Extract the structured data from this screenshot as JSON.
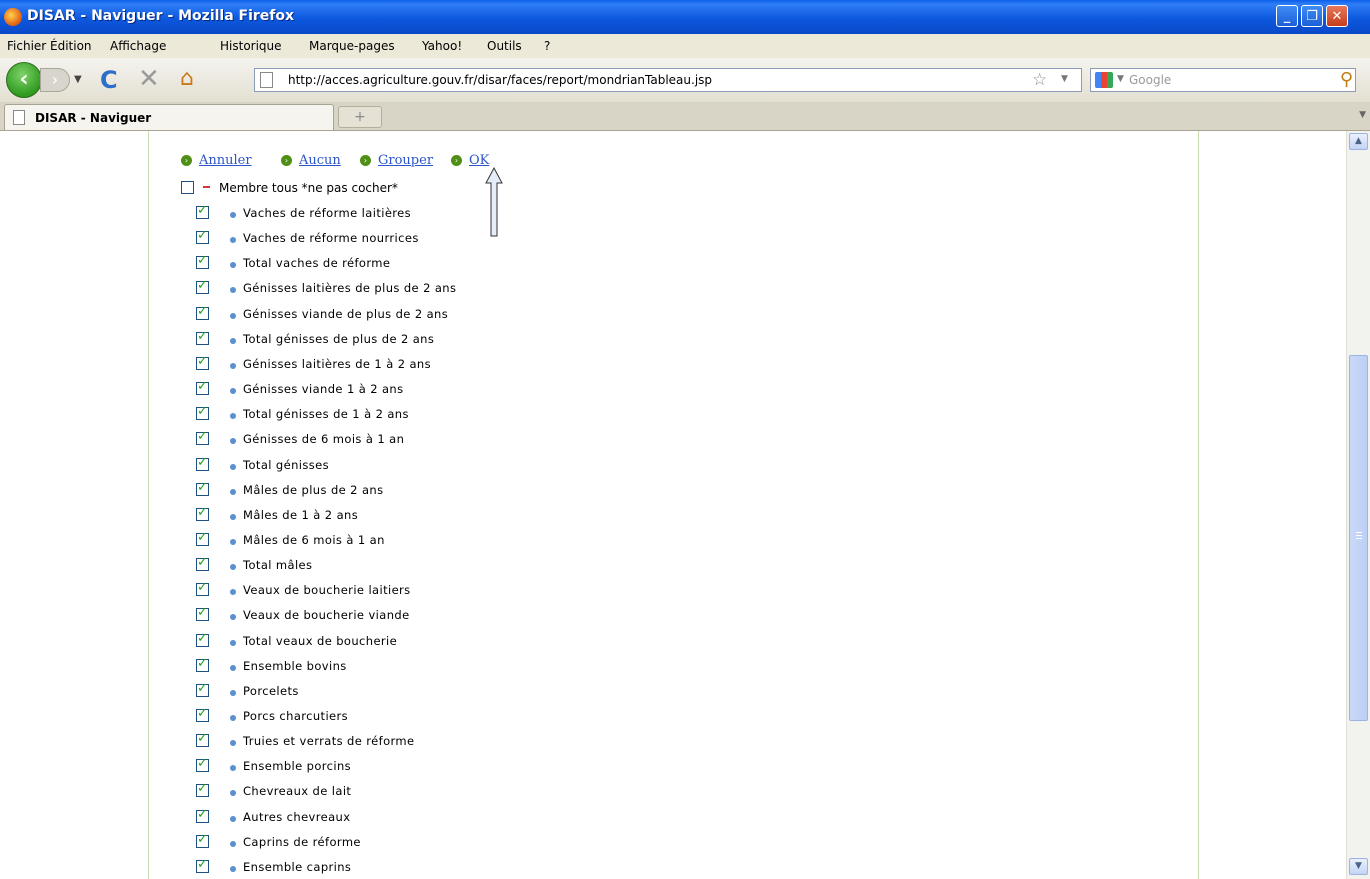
{
  "window": {
    "title": "DISAR - Naviguer - Mozilla Firefox"
  },
  "menu": [
    "Fichier",
    "Édition",
    "Affichage",
    "Historique",
    "Marque-pages",
    "Yahoo!",
    "Outils",
    "?"
  ],
  "nav": {
    "url": "http://acces.agriculture.gouv.fr/disar/faces/report/mondrianTableau.jsp",
    "search_placeholder": "Google"
  },
  "tab": {
    "label": "DISAR - Naviguer"
  },
  "actions": [
    "Annuler",
    "Aucun",
    "Grouper",
    "OK"
  ],
  "tree": {
    "root": {
      "label": "Membre tous *ne pas cocher*",
      "checked": false
    },
    "items": [
      "Vaches de réforme laitières",
      "Vaches de réforme nourrices",
      "Total vaches de réforme",
      "Génisses laitières de plus de 2 ans",
      "Génisses viande de plus de 2 ans",
      "Total génisses de plus de 2 ans",
      "Génisses laitières de 1 à 2 ans",
      "Génisses viande 1 à 2 ans",
      "Total génisses de 1 à 2 ans",
      "Génisses de 6 mois à 1 an",
      "Total génisses",
      "Mâles de plus de 2 ans",
      "Mâles de 1 à 2 ans",
      "Mâles de 6 mois à 1 an",
      "Total mâles",
      "Veaux de boucherie laitiers",
      "Veaux de boucherie viande",
      "Total veaux de boucherie",
      "Ensemble bovins",
      "Porcelets",
      "Porcs charcutiers",
      "Truies et verrats de réforme",
      "Ensemble porcins",
      "Chevreaux de lait",
      "Autres chevreaux",
      "Caprins de réforme",
      "Ensemble caprins"
    ],
    "items_checked": true
  },
  "colors": {
    "link": "#2b55c8",
    "check": "#21a121",
    "bullet": "#5a8fd0",
    "action_bullet": "#4f8f15",
    "titlebar": "#0a5fe8"
  }
}
